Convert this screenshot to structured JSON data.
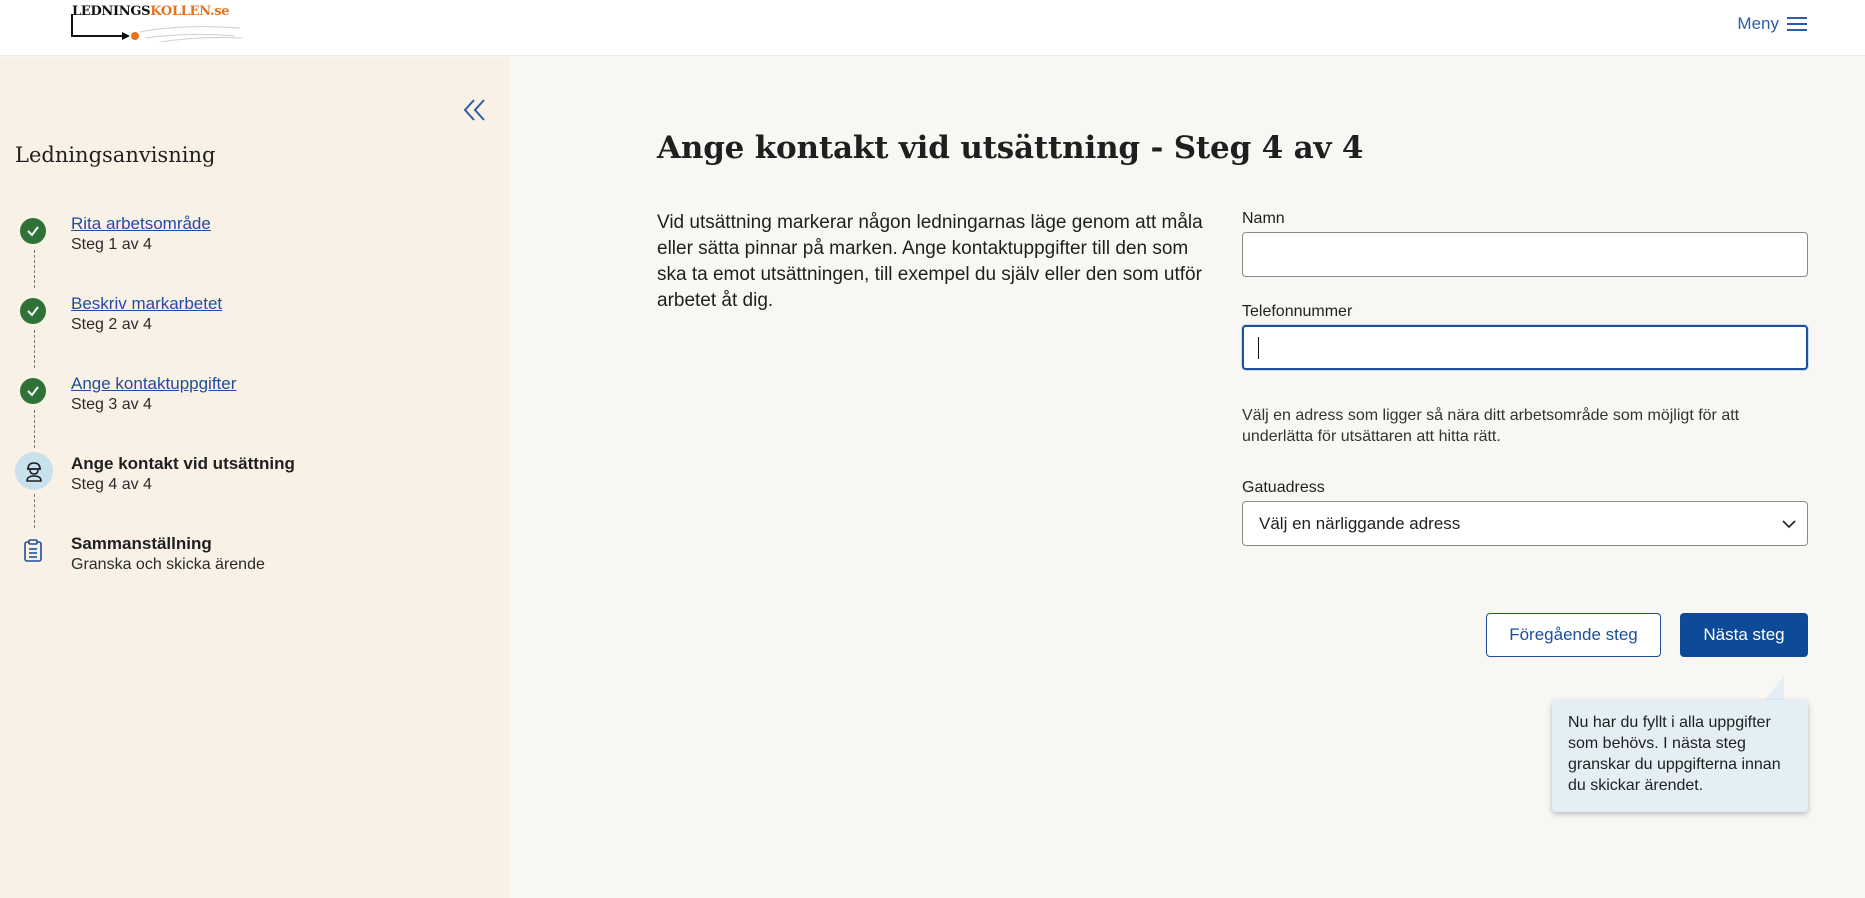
{
  "header": {
    "logo": {
      "text_main": "LEDNINGS",
      "text_accent": "KOLLEN.se"
    },
    "menu_label": "Meny"
  },
  "sidebar": {
    "title": "Ledningsanvisning",
    "steps": [
      {
        "title": "Rita arbetsområde",
        "subtitle": "Steg 1 av 4",
        "status": "done",
        "icon": "check-icon"
      },
      {
        "title": "Beskriv markarbetet",
        "subtitle": "Steg 2 av 4",
        "status": "done",
        "icon": "check-icon"
      },
      {
        "title": "Ange kontaktuppgifter",
        "subtitle": "Steg 3 av 4",
        "status": "done",
        "icon": "check-icon"
      },
      {
        "title": "Ange kontakt vid utsättning",
        "subtitle": "Steg 4 av 4",
        "status": "current",
        "icon": "worker-icon"
      },
      {
        "title": "Sammanställning",
        "subtitle": "Granska och skicka ärende",
        "status": "todo",
        "icon": "clipboard-icon"
      }
    ]
  },
  "main": {
    "title": "Ange kontakt vid utsättning - Steg 4 av 4",
    "intro": "Vid utsättning markerar någon ledningarnas läge genom att måla eller sätta pinnar på marken. Ange kontaktuppgifter till den som ska ta emot utsättningen, till exempel du själv eller den som utför arbetet åt dig.",
    "form": {
      "name_label": "Namn",
      "name_value": "",
      "phone_label": "Telefonnummer",
      "phone_value": "",
      "address_hint": "Välj en adress som ligger så nära ditt arbetsområde som möjligt för att underlätta för utsättaren att hitta rätt.",
      "street_label": "Gatuadress",
      "street_selected": "Välj en närliggande adress"
    },
    "buttons": {
      "previous": "Föregående steg",
      "next": "Nästa steg"
    },
    "tooltip": "Nu har du fyllt i alla uppgifter som behövs. I nästa steg granskar du uppgifterna innan du skickar ärendet."
  },
  "colors": {
    "primary": "#0d4a97",
    "done": "#2e7237",
    "sidebar_bg": "#f9f1e6",
    "tooltip_bg": "#e3eff5",
    "logo_accent": "#e8731d"
  }
}
